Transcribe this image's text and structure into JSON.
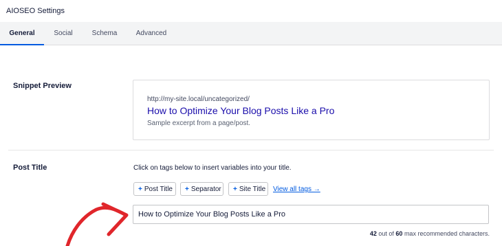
{
  "header": {
    "title": "AIOSEO Settings"
  },
  "tabs": [
    {
      "label": "General",
      "active": true
    },
    {
      "label": "Social",
      "active": false
    },
    {
      "label": "Schema",
      "active": false
    },
    {
      "label": "Advanced",
      "active": false
    }
  ],
  "snippet_preview": {
    "label": "Snippet Preview",
    "url": "http://my-site.local/uncategorized/",
    "title": "How to Optimize Your Blog Posts Like a Pro",
    "description": "Sample excerpt from a page/post."
  },
  "post_title": {
    "label": "Post Title",
    "help_text": "Click on tags below to insert variables into your title.",
    "tags": [
      {
        "plus": "+",
        "label": "Post Title"
      },
      {
        "plus": "+",
        "label": "Separator"
      },
      {
        "plus": "+",
        "label": "Site Title"
      }
    ],
    "view_all_label": "View all tags →",
    "input_value": "How to Optimize Your Blog Posts Like a Pro",
    "char_count": {
      "current": "42",
      "mid_text": "out of",
      "max": "60",
      "end_text": "max recommended characters."
    }
  },
  "colors": {
    "accent": "#005ae0",
    "link_title": "#1a0dab",
    "annotation_arrow": "#e0262b"
  },
  "icons": {
    "annotation": "red-hand-drawn-arrow"
  }
}
